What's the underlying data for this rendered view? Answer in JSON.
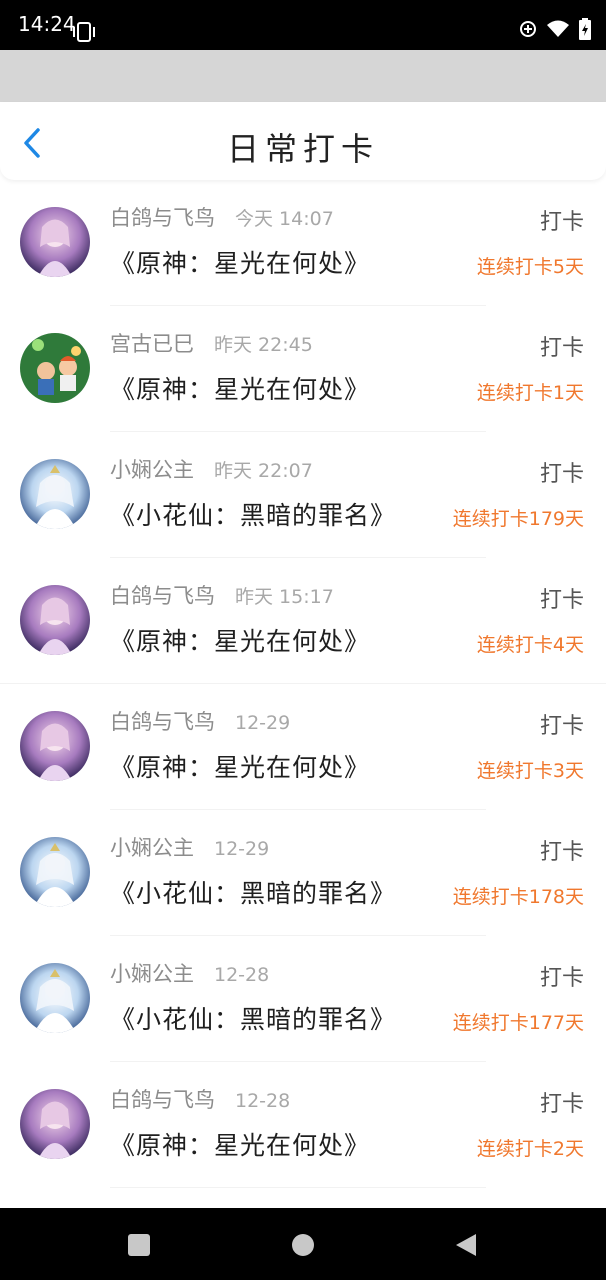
{
  "statusbar": {
    "time": "14:24",
    "icons": [
      "vibrate-icon",
      "data-saver-icon",
      "wifi-icon",
      "battery-icon"
    ]
  },
  "header": {
    "title": "日常打卡",
    "back_icon": "chevron-left-icon",
    "accent": "#1e88e5"
  },
  "colors": {
    "streak": "#f0782e",
    "name": "#8c8c8c"
  },
  "list": {
    "items": [
      {
        "user": "白鸽与飞鸟",
        "time": "今天 14:07",
        "book": "《原神：星光在何处》",
        "action": "打卡",
        "streak": "连续打卡5天",
        "avatar": "purple"
      },
      {
        "user": "宫古已巳",
        "time": "昨天 22:45",
        "book": "《原神：星光在何处》",
        "action": "打卡",
        "streak": "连续打卡1天",
        "avatar": "green"
      },
      {
        "user": "小娴公主",
        "time": "昨天 22:07",
        "book": "《小花仙：黑暗的罪名》",
        "action": "打卡",
        "streak": "连续打卡179天",
        "avatar": "blue"
      },
      {
        "user": "白鸽与飞鸟",
        "time": "昨天 15:17",
        "book": "《原神：星光在何处》",
        "action": "打卡",
        "streak": "连续打卡4天",
        "avatar": "purple"
      },
      {
        "user": "白鸽与飞鸟",
        "time": "12-29",
        "book": "《原神：星光在何处》",
        "action": "打卡",
        "streak": "连续打卡3天",
        "avatar": "purple"
      },
      {
        "user": "小娴公主",
        "time": "12-29",
        "book": "《小花仙：黑暗的罪名》",
        "action": "打卡",
        "streak": "连续打卡178天",
        "avatar": "blue"
      },
      {
        "user": "小娴公主",
        "time": "12-28",
        "book": "《小花仙：黑暗的罪名》",
        "action": "打卡",
        "streak": "连续打卡177天",
        "avatar": "blue"
      },
      {
        "user": "白鸽与飞鸟",
        "time": "12-28",
        "book": "《原神：星光在何处》",
        "action": "打卡",
        "streak": "连续打卡2天",
        "avatar": "purple"
      }
    ]
  },
  "navbar": {
    "icons": [
      "recents-square-icon",
      "home-circle-icon",
      "back-triangle-icon"
    ]
  }
}
